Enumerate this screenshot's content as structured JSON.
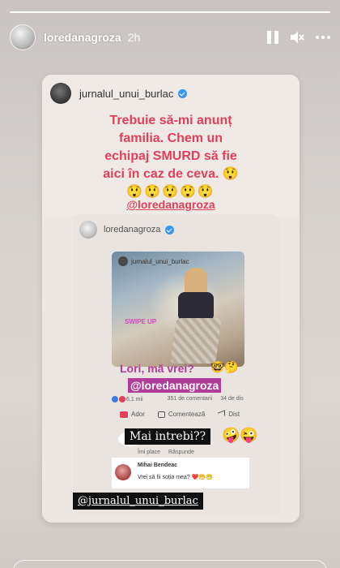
{
  "header": {
    "username": "loredanagroza",
    "time": "2h"
  },
  "shared_post": {
    "username": "jurnalul_unui_burlac",
    "text_lines": [
      "Trebuie să-mi anunț",
      "familia. Chem un",
      "echipaj SMURD să fie",
      "aici în caz de ceva. 😲"
    ],
    "emoji_row": "😲😲😲😲😲",
    "mention": "@loredanagroza"
  },
  "repost": {
    "username": "loredanagroza",
    "photo_user": "jurnalul_unui_burlac",
    "swipe_text": "SWIPE UP",
    "caption": "Lori, mă vrei?",
    "caption_emoji": "🤓🤔",
    "caption_mention": "@loredanagroza",
    "fb_stats": {
      "reactions": "6,1 mii",
      "comments": "351 de comentarii",
      "shares": "34 de dis"
    },
    "fb_actions": {
      "like": "Ador",
      "comment": "Comentează",
      "share": "Dist"
    },
    "reply_label": "Mai intrebi??",
    "reply_emoji": "🤪😜",
    "reply_row": {
      "like": "Îmi place",
      "reply": "Răspunde"
    },
    "comment": {
      "name": "Mihai Bendeac",
      "text": "Vrei să fii soția mea? ❤️😁😁"
    }
  },
  "bottom_tag": "@jurnalul_unui_burlac",
  "colors": {
    "accent_red": "#e2405a",
    "accent_pink": "#b23c9a",
    "verified_blue": "#3797f0"
  }
}
